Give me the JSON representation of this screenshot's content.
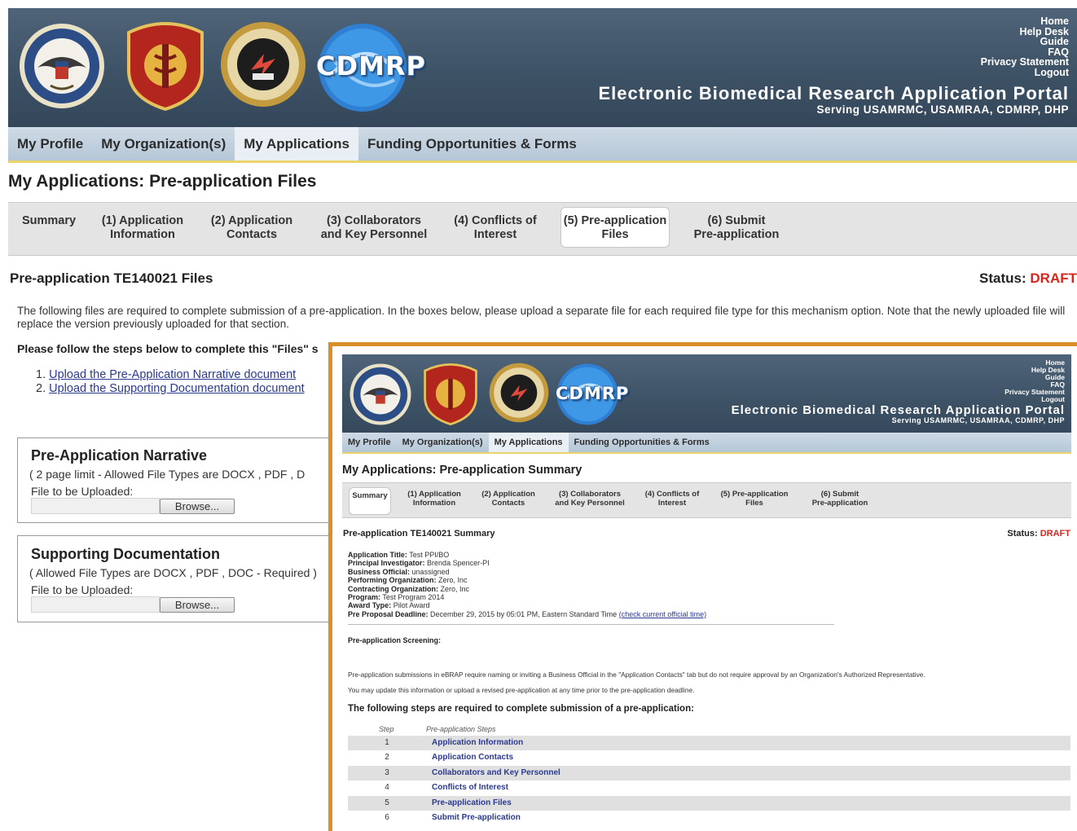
{
  "portal": {
    "title": "Electronic Biomedical Research Application Portal",
    "serving": "Serving USAMRMC, USAMRAA, CDMRP, DHP",
    "cdmrp_logo": "CDMRP",
    "toplinks": [
      "Home",
      "Help Desk",
      "Guide",
      "FAQ",
      "Privacy Statement",
      "Logout"
    ],
    "seals": [
      "dod-seal-icon",
      "protect-sustain-seal-icon",
      "usamraa-seal-icon",
      "cdmrp-logo-icon"
    ]
  },
  "nav": {
    "items": [
      "My Profile",
      "My Organization(s)",
      "My Applications",
      "Funding Opportunities & Forms"
    ],
    "active": "My Applications"
  },
  "tabs": [
    {
      "line1": "Summary",
      "line2": ""
    },
    {
      "line1": "(1) Application",
      "line2": "Information"
    },
    {
      "line1": "(2) Application",
      "line2": "Contacts"
    },
    {
      "line1": "(3) Collaborators",
      "line2": "and Key Personnel"
    },
    {
      "line1": "(4) Conflicts of",
      "line2": "Interest"
    },
    {
      "line1": "(5) Pre-application",
      "line2": "Files"
    },
    {
      "line1": "(6) Submit",
      "line2": "Pre-application"
    }
  ],
  "files_page": {
    "page_title": "My Applications: Pre-application Files",
    "active_tab": 5,
    "section_title": "Pre-application TE140021 Files",
    "status_label": "Status:",
    "status_value": "DRAFT",
    "intro": "The following files are required to complete submission of a pre-application. In the boxes below, please upload a separate file for each required file type for this mechanism option. Note that the newly uploaded file will replace the version previously uploaded for that section.",
    "steps_intro": "Please follow the steps below to complete this \"Files\" s",
    "steps": [
      {
        "num": "1.",
        "text": "Upload the Pre-Application Narrative document"
      },
      {
        "num": "2.",
        "text": "Upload the Supporting Documentation document"
      }
    ],
    "narrative": {
      "title": "Pre-Application Narrative",
      "sub": "( 2 page limit  -   Allowed File Types are DOCX , PDF , D",
      "file_label": "File to be Uploaded:",
      "browse": "Browse..."
    },
    "supporting": {
      "title": "Supporting Documentation",
      "sub": "( Allowed File Types are DOCX , PDF , DOC - Required )",
      "file_label": "File to be Uploaded:",
      "browse": "Browse..."
    }
  },
  "summary_page": {
    "page_title": "My Applications: Pre-application Summary",
    "active_tab": 0,
    "section_title": "Pre-application TE140021 Summary",
    "status_label": "Status:",
    "status_value": "DRAFT",
    "fields": [
      {
        "label": "Application Title:",
        "value": "Test PPI/BO"
      },
      {
        "label": "Principal Investigator:",
        "value": "Brenda Spencer-PI"
      },
      {
        "label": "Business Official:",
        "value": "unassigned"
      },
      {
        "label": "Performing Organization:",
        "value": "Zero, Inc"
      },
      {
        "label": "Contracting Organization:",
        "value": "Zero, Inc"
      },
      {
        "label": "Program:",
        "value": "Test Program 2014"
      },
      {
        "label": "Award Type:",
        "value": "Pilot Award"
      }
    ],
    "deadline_label": "Pre Proposal Deadline:",
    "deadline_value": "December 29, 2015 by 05:01 PM, Eastern Standard Time",
    "deadline_link": "(check current official time)",
    "screening_label": "Pre-application Screening:",
    "note1": "Pre-application submissions in eBRAP require naming or inviting a Business Official in the \"Application Contacts\" tab but do not require approval by an Organization's Authorized Representative.",
    "note2": "You may update this information or upload a revised pre-application at any time prior to the pre-application deadline.",
    "steps_heading": "The following steps are required to complete submission of a pre-application:",
    "steps_col_step": "Step",
    "steps_col_name": "Pre-application Steps",
    "steps": [
      {
        "num": "1",
        "name": "Application Information"
      },
      {
        "num": "2",
        "name": "Application Contacts"
      },
      {
        "num": "3",
        "name": "Collaborators and Key Personnel"
      },
      {
        "num": "4",
        "name": "Conflicts of Interest"
      },
      {
        "num": "5",
        "name": "Pre-application Files"
      },
      {
        "num": "6",
        "name": "Submit Pre-application"
      }
    ]
  }
}
